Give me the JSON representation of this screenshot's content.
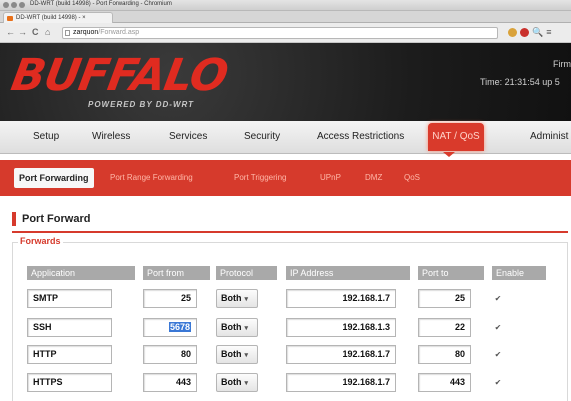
{
  "browser": {
    "window_title": "DD-WRT (build 14998) - Port Forwarding - Chromium",
    "tab_title": "DD-WRT (build 14998) - ×",
    "url_host": "zarquon",
    "url_path": "/Forward.asp",
    "nav_back": "←",
    "nav_forward": "→",
    "nav_reload": "C",
    "nav_home": "⌂"
  },
  "header": {
    "logo_text": "BUFFALO",
    "logo_sub": "POWERED BY DD-WRT",
    "firmware_label": "Firm",
    "time_label": "Time: 21:31:54 up 5"
  },
  "main_tabs": [
    {
      "label": "Setup"
    },
    {
      "label": "Wireless"
    },
    {
      "label": "Services"
    },
    {
      "label": "Security"
    },
    {
      "label": "Access Restrictions"
    },
    {
      "label": "NAT / QoS"
    },
    {
      "label": "Administ"
    }
  ],
  "active_main_tab": "NAT / QoS",
  "sub_tabs": [
    {
      "label": "Port Forwarding"
    },
    {
      "label": "Port Range Forwarding"
    },
    {
      "label": "Port Triggering"
    },
    {
      "label": "UPnP"
    },
    {
      "label": "DMZ"
    },
    {
      "label": "QoS"
    }
  ],
  "active_sub_tab": "Port Forwarding",
  "section": {
    "title": "Port Forward",
    "legend": "Forwards"
  },
  "table": {
    "headers": [
      "Application",
      "Port from",
      "Protocol",
      "IP Address",
      "Port to",
      "Enable"
    ],
    "rows": [
      {
        "application": "SMTP",
        "port_from": "25",
        "protocol": "Both",
        "ip": "192.168.1.7",
        "port_to": "25",
        "enabled": true
      },
      {
        "application": "SSH",
        "port_from": "5678",
        "protocol": "Both",
        "ip": "192.168.1.3",
        "port_to": "22",
        "enabled": true
      },
      {
        "application": "HTTP",
        "port_from": "80",
        "protocol": "Both",
        "ip": "192.168.1.7",
        "port_to": "80",
        "enabled": true
      },
      {
        "application": "HTTPS",
        "port_from": "443",
        "protocol": "Both",
        "ip": "192.168.1.7",
        "port_to": "443",
        "enabled": true
      }
    ]
  },
  "colors": {
    "brand_red": "#d63a2c",
    "logo_red": "#e02b20",
    "header_dark": "#1c1c1c",
    "column_header_gray": "#a9a9a9",
    "selection_blue": "#3a78d6"
  },
  "icons": {
    "checkbox": "✔",
    "dropdown": "▾"
  }
}
